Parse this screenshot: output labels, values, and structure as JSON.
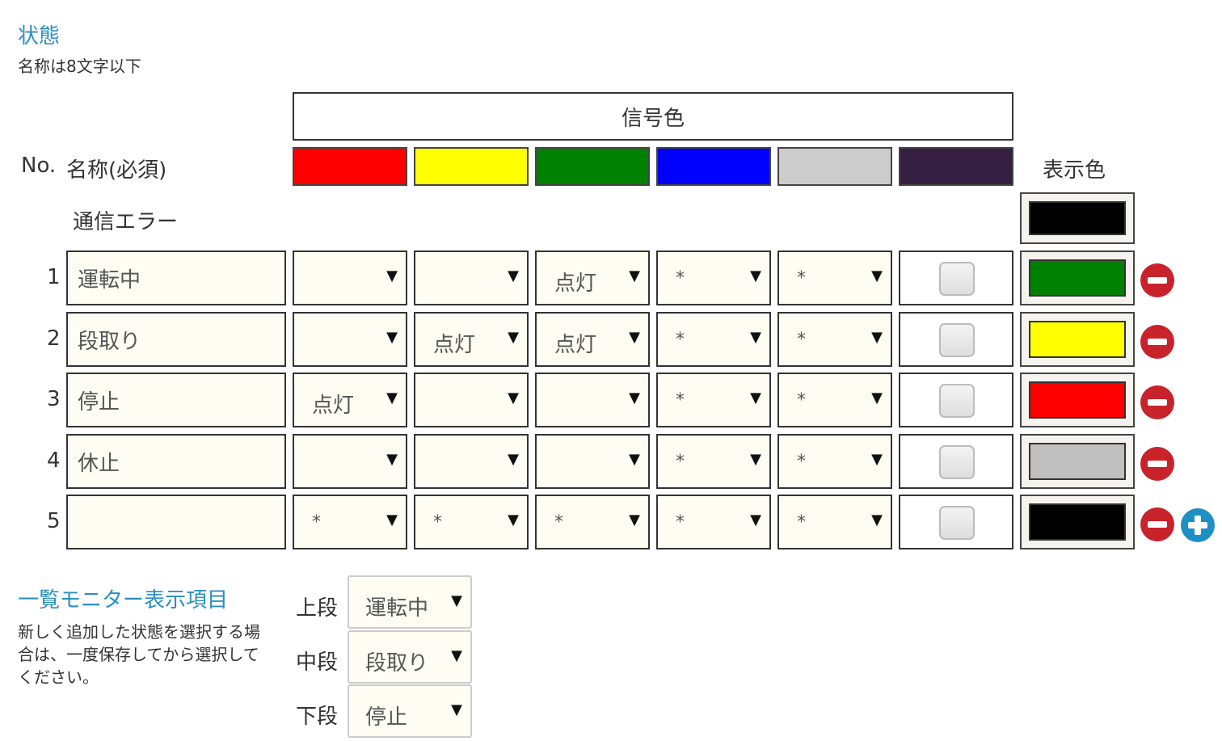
{
  "section_title": "状態",
  "name_note": "名称は8文字以下",
  "signal_header": "信号色",
  "col_no": "No.",
  "col_name": "名称(必須)",
  "col_display": "表示色",
  "signal_colors": [
    "#ff0000",
    "#ffff00",
    "#008000",
    "#0000ff",
    "#cccccc",
    "#341f41"
  ],
  "comm_error": {
    "label": "通信エラー",
    "display_color": "#000000"
  },
  "rows": [
    {
      "no": "1",
      "name": "運転中",
      "signals": [
        "",
        "",
        "点灯",
        "*",
        "*"
      ],
      "display_color": "#008000"
    },
    {
      "no": "2",
      "name": "段取り",
      "signals": [
        "",
        "点灯",
        "点灯",
        "*",
        "*"
      ],
      "display_color": "#ffff00"
    },
    {
      "no": "3",
      "name": "停止",
      "signals": [
        "点灯",
        "",
        "",
        "*",
        "*"
      ],
      "display_color": "#ff0000"
    },
    {
      "no": "4",
      "name": "休止",
      "signals": [
        "",
        "",
        "",
        "*",
        "*"
      ],
      "display_color": "#c0c0c0"
    },
    {
      "no": "5",
      "name": "",
      "signals": [
        "*",
        "*",
        "*",
        "*",
        "*"
      ],
      "display_color": "#000000"
    }
  ],
  "dropdown_arrow": "▼",
  "monitor": {
    "title": "一覧モニター表示項目",
    "note_lines": [
      "新しく追加した状態を選択する場",
      "合は、一度保存してから選択して",
      "ください。"
    ],
    "items": [
      {
        "label": "上段",
        "value": "運転中"
      },
      {
        "label": "中段",
        "value": "段取り"
      },
      {
        "label": "下段",
        "value": "停止"
      }
    ]
  },
  "icons": {
    "remove": "minus-circle-icon",
    "add": "plus-circle-icon"
  }
}
